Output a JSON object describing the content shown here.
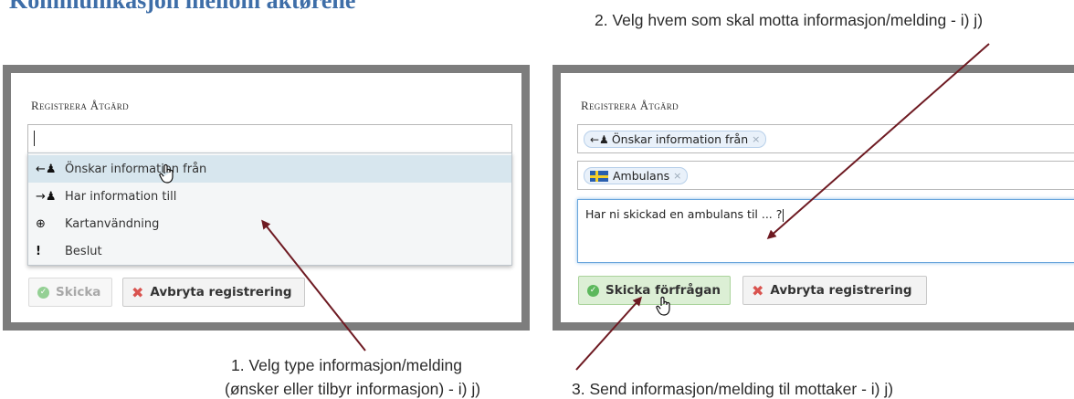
{
  "page_title": "Kommunikasjon mellom aktørene",
  "callouts": {
    "step1_line1": "1. Velg type informasjon/melding",
    "step1_line2": "(ønsker eller tilbyr informasjon) - i) j)",
    "step2": "2. Velg hvem som skal motta informasjon/melding - i) j)",
    "step3": "3. Send informasjon/melding til mottaker - i) j)"
  },
  "left_panel": {
    "heading": "Registrera Åtgärd",
    "search_value": "",
    "dropdown_items": [
      {
        "icon": "arrow-left-person-icon",
        "glyph": "←♟",
        "label": "Önskar information från",
        "selected": true
      },
      {
        "icon": "arrow-right-person-icon",
        "glyph": "→♟",
        "label": "Har information till",
        "selected": false
      },
      {
        "icon": "globe-icon",
        "glyph": "⊕",
        "label": "Kartanvändning",
        "selected": false
      },
      {
        "icon": "exclamation-icon",
        "glyph": "!",
        "label": "Beslut",
        "selected": false
      }
    ],
    "send_button": "Skicka",
    "cancel_button": "Avbryta registrering"
  },
  "right_panel": {
    "heading": "Registrera Åtgärd",
    "type_token": "Önskar information från",
    "recipient_token": "Ambulans",
    "message": "Har ni skickad en ambulans til ... ?",
    "send_button": "Skicka förfrågan",
    "cancel_button": "Avbryta registrering"
  },
  "colors": {
    "arrow": "#6e1a22",
    "title": "#3e6ea8",
    "frame": "#7d7d7d",
    "success": "#5cb85c",
    "danger": "#d9534f"
  }
}
